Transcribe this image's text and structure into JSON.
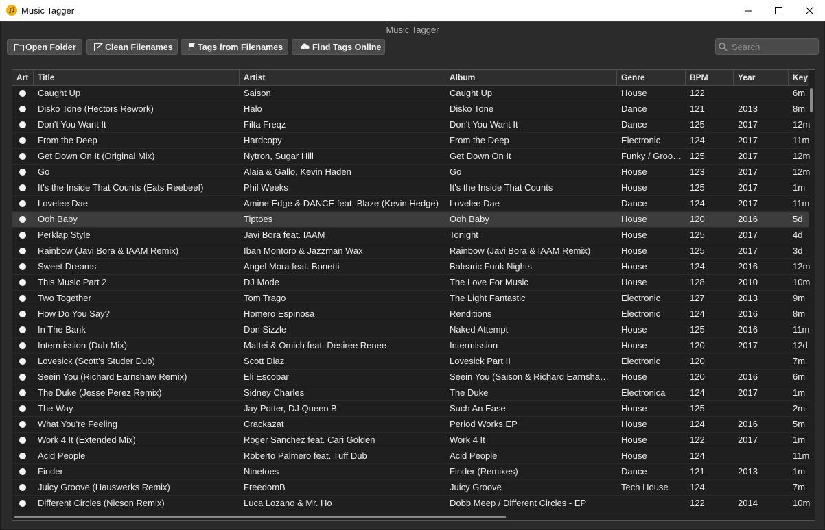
{
  "window": {
    "title": "Music Tagger"
  },
  "app": {
    "title": "Music Tagger",
    "toolbar": {
      "open_folder": "Open Folder",
      "clean_filenames": "Clean Filenames",
      "tags_from_filenames": "Tags from Filenames",
      "find_tags_online": "Find Tags Online"
    },
    "search": {
      "placeholder": "Search",
      "value": ""
    }
  },
  "table": {
    "columns": [
      "Art",
      "Title",
      "Artist",
      "Album",
      "Genre",
      "BPM",
      "Year",
      "Key"
    ],
    "selected_row_index": 8,
    "rows": [
      {
        "title": "Caught Up",
        "artist": "Saison",
        "album": "Caught Up",
        "genre": "House",
        "bpm": "122",
        "year": "",
        "key": "6m"
      },
      {
        "title": "Disko Tone (Hectors Rework)",
        "artist": "Halo",
        "album": "Disko Tone",
        "genre": "Dance",
        "bpm": "121",
        "year": "2013",
        "key": "8m"
      },
      {
        "title": "Don't You Want It",
        "artist": "Filta Freqz",
        "album": "Don't You Want It",
        "genre": "Dance",
        "bpm": "125",
        "year": "2017",
        "key": "12m"
      },
      {
        "title": "From the Deep",
        "artist": "Hardcopy",
        "album": "From the Deep",
        "genre": "Electronic",
        "bpm": "124",
        "year": "2017",
        "key": "11m"
      },
      {
        "title": "Get Down On It (Original Mix)",
        "artist": "Nytron, Sugar Hill",
        "album": "Get Down On It",
        "genre": "Funky / Groo…",
        "bpm": "125",
        "year": "2017",
        "key": "12m"
      },
      {
        "title": "Go",
        "artist": "Alaia & Gallo, Kevin Haden",
        "album": "Go",
        "genre": "House",
        "bpm": "123",
        "year": "2017",
        "key": "12m"
      },
      {
        "title": "It's the Inside That Counts (Eats Reebeef)",
        "artist": "Phil Weeks",
        "album": "It's the Inside That Counts",
        "genre": "House",
        "bpm": "125",
        "year": "2017",
        "key": "1m"
      },
      {
        "title": "Lovelee Dae",
        "artist": "Amine Edge & DANCE feat. Blaze (Kevin Hedge)",
        "album": "Lovelee Dae",
        "genre": "Dance",
        "bpm": "124",
        "year": "2017",
        "key": "11m"
      },
      {
        "title": "Ooh Baby",
        "artist": "Tiptoes",
        "album": "Ooh Baby",
        "genre": "House",
        "bpm": "120",
        "year": "2016",
        "key": "5d"
      },
      {
        "title": "Perklap Style",
        "artist": "Javi Bora feat. IAAM",
        "album": "Tonight",
        "genre": "House",
        "bpm": "125",
        "year": "2017",
        "key": "4d"
      },
      {
        "title": "Rainbow (Javi Bora & IAAM Remix)",
        "artist": "Iban Montoro & Jazzman Wax",
        "album": "Rainbow (Javi Bora & IAAM Remix)",
        "genre": "House",
        "bpm": "125",
        "year": "2017",
        "key": "3d"
      },
      {
        "title": "Sweet Dreams",
        "artist": "Angel Mora feat. Bonetti",
        "album": "Balearic Funk Nights",
        "genre": "House",
        "bpm": "124",
        "year": "2016",
        "key": "12m"
      },
      {
        "title": "This Music Part 2",
        "artist": "DJ Mode",
        "album": "The Love For Music",
        "genre": "House",
        "bpm": "128",
        "year": "2010",
        "key": "10m"
      },
      {
        "title": "Two Together",
        "artist": "Tom Trago",
        "album": "The Light Fantastic",
        "genre": "Electronic",
        "bpm": "127",
        "year": "2013",
        "key": "9m"
      },
      {
        "title": "How Do You Say?",
        "artist": "Homero Espinosa",
        "album": "Renditions",
        "genre": "Electronic",
        "bpm": "124",
        "year": "2016",
        "key": "8m"
      },
      {
        "title": "In The Bank",
        "artist": "Don Sizzle",
        "album": "Naked Attempt",
        "genre": "House",
        "bpm": "125",
        "year": "2016",
        "key": "11m"
      },
      {
        "title": "Intermission (Dub Mix)",
        "artist": "Mattei & Omich feat. Desiree Renee",
        "album": "Intermission",
        "genre": "House",
        "bpm": "120",
        "year": "2017",
        "key": "12d"
      },
      {
        "title": "Lovesick (Scott's Studer Dub)",
        "artist": "Scott Diaz",
        "album": "Lovesick Part II",
        "genre": "Electronic",
        "bpm": "120",
        "year": "",
        "key": "7m"
      },
      {
        "title": "Seein You (Richard Earnshaw Remix)",
        "artist": "Eli Escobar",
        "album": "Seein You (Saison & Richard Earnsha…",
        "genre": "House",
        "bpm": "120",
        "year": "2016",
        "key": "6m"
      },
      {
        "title": "The Duke (Jesse Perez Remix)",
        "artist": "Sidney Charles",
        "album": "The Duke",
        "genre": "Electronica",
        "bpm": "124",
        "year": "2017",
        "key": "1m"
      },
      {
        "title": "The Way",
        "artist": "Jay Potter, DJ Queen B",
        "album": "Such An Ease",
        "genre": "House",
        "bpm": "125",
        "year": "",
        "key": "2m"
      },
      {
        "title": "What You're Feeling",
        "artist": "Crackazat",
        "album": "Period Works EP",
        "genre": "House",
        "bpm": "124",
        "year": "2016",
        "key": "5m"
      },
      {
        "title": "Work 4 It (Extended Mix)",
        "artist": "Roger Sanchez feat. Cari Golden",
        "album": "Work 4 It",
        "genre": "House",
        "bpm": "122",
        "year": "2017",
        "key": "1m"
      },
      {
        "title": "Acid People",
        "artist": "Roberto Palmero feat. Tuff Dub",
        "album": "Acid People",
        "genre": "House",
        "bpm": "124",
        "year": "",
        "key": "11m"
      },
      {
        "title": "Finder",
        "artist": "Ninetoes",
        "album": "Finder (Remixes)",
        "genre": "Dance",
        "bpm": "121",
        "year": "2013",
        "key": "1m"
      },
      {
        "title": "Juicy Groove (Hauswerks Remix)",
        "artist": "FreedomB",
        "album": "Juicy Groove",
        "genre": "Tech House",
        "bpm": "124",
        "year": "",
        "key": "7m"
      },
      {
        "title": "Different Circles (Nicson Remix)",
        "artist": "Luca Lozano & Mr. Ho",
        "album": "Dobb Meep / Different Circles - EP",
        "genre": "",
        "bpm": "122",
        "year": "2014",
        "key": "10m"
      }
    ]
  },
  "colors": {
    "app_background": "#2b2b2b",
    "table_background": "#1f1f1f",
    "selected_row": "#3d3d3d",
    "button": "#4a4a4a",
    "text": "#ececec",
    "app_icon": "#f0b400"
  },
  "icons": {
    "app": "music-note-icon",
    "open_folder": "folder-icon",
    "clean_filenames": "edit-icon",
    "tags_from_filenames": "flag-icon",
    "find_tags_online": "cloud-download-icon",
    "search": "search-icon",
    "art": "dot-icon"
  }
}
